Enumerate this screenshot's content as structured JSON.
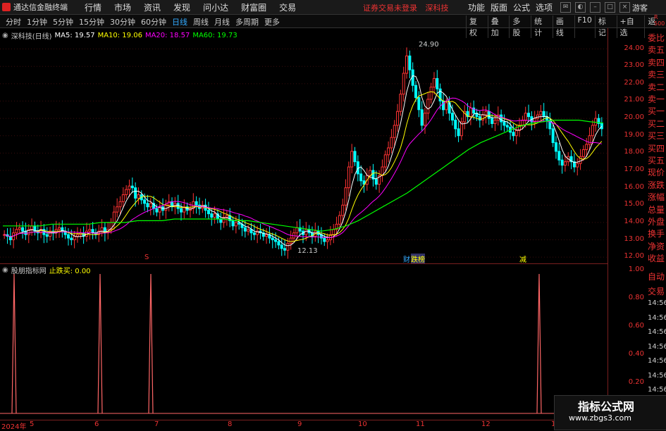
{
  "app": {
    "title": "通达信金融终端",
    "guest": "游客",
    "status_left": "证券交易未登录",
    "status_right": "深科技"
  },
  "menu": [
    "行情",
    "市场",
    "资讯",
    "发现",
    "问小达",
    "财富圈",
    "交易"
  ],
  "top_right": [
    "功能",
    "版面",
    "公式",
    "选项"
  ],
  "period_tabs": [
    "分时",
    "1分钟",
    "5分钟",
    "15分钟",
    "30分钟",
    "60分钟",
    "日线",
    "周线",
    "月线",
    "多周期",
    "更多"
  ],
  "active_tab": "日线",
  "right_tabs": [
    "复权",
    "叠加",
    "多股",
    "统计",
    "画线",
    "F10",
    "标记",
    "+自选",
    "返回"
  ],
  "legend": {
    "title": "深科技(日线)",
    "ma5": "MA5: 19.57",
    "ma10": "MA10: 19.06",
    "ma20": "MA20: 18.57",
    "ma60": "MA60: 19.73"
  },
  "colors": {
    "ma5": "#ffffff",
    "ma10": "#ffff00",
    "ma20": "#ff00ff",
    "ma60": "#00ff00",
    "up": "#ff3333",
    "down": "#00ffff",
    "indicator": "#ff6666"
  },
  "price_axis": [
    "24.00",
    "23.00",
    "22.00",
    "21.00",
    "20.00",
    "19.00",
    "18.00",
    "17.00",
    "16.00",
    "15.00",
    "14.00",
    "13.00",
    "12.00"
  ],
  "sub_axis": [
    "1.00",
    "0.80",
    "0.60",
    "0.40",
    "0.20"
  ],
  "annotations": {
    "high": "24.90",
    "low": "12.13",
    "marker_s": "S",
    "marker_c": "财",
    "marker_rank": "跌榜",
    "marker_j": "减"
  },
  "side_panel": [
    "委比",
    "卖五",
    "卖四",
    "卖三",
    "卖二",
    "卖一",
    "买一",
    "买二",
    "买三",
    "买四",
    "买五",
    "现价",
    "涨跌",
    "涨幅",
    "总量",
    "外盘",
    "换手",
    "净资",
    "收益"
  ],
  "side_sub": [
    "自动",
    "交易",
    "14:56",
    "14:56",
    "14:56",
    "14:56",
    "14:56",
    "14:56",
    "14:56",
    "14:56"
  ],
  "side_r": "R 500",
  "sub_legend": {
    "name": "股朋指标网",
    "value": "止跌买: 0.00"
  },
  "x_labels": [
    "2024年",
    "5",
    "6",
    "7",
    "8",
    "9",
    "10",
    "11",
    "12",
    "1"
  ],
  "watermark": {
    "line1": "指标公式网",
    "line2": "www.zbgs3.com"
  },
  "chart_data": {
    "type": "candlestick",
    "ylim": [
      11.6,
      25.2
    ],
    "closes": [
      13.3,
      13.2,
      13.0,
      13.4,
      13.6,
      13.7,
      13.5,
      13.3,
      13.6,
      13.8,
      13.5,
      13.4,
      13.6,
      13.3,
      13.2,
      13.5,
      13.4,
      13.6,
      13.7,
      13.5,
      13.3,
      13.1,
      13.0,
      13.2,
      13.3,
      13.4,
      13.2,
      13.5,
      13.6,
      13.4,
      13.3,
      13.5,
      13.7,
      13.4,
      13.6,
      14.0,
      14.6,
      14.9,
      15.2,
      15.6,
      15.9,
      16.1,
      16.0,
      15.4,
      15.6,
      15.3,
      15.1,
      14.9,
      15.1,
      14.8,
      14.6,
      14.9,
      14.7,
      15.0,
      15.2,
      14.9,
      15.1,
      14.8,
      14.6,
      14.9,
      14.7,
      14.8,
      15.2,
      15.0,
      14.8,
      15.0,
      14.7,
      14.5,
      14.3,
      14.5,
      14.2,
      14.0,
      14.3,
      14.4,
      14.1,
      13.8,
      14.0,
      13.9,
      13.7,
      13.5,
      13.6,
      13.4,
      13.3,
      13.5,
      13.4,
      13.2,
      13.3,
      13.1,
      13.0,
      12.9,
      12.7,
      12.5,
      12.4,
      12.8,
      13.1,
      13.4,
      13.7,
      13.5,
      13.3,
      13.6,
      13.4,
      13.2,
      13.5,
      13.3,
      13.1,
      12.9,
      13.0,
      13.3,
      13.6,
      13.9,
      14.4,
      15.0,
      16.0,
      17.2,
      18.1,
      17.5,
      16.8,
      16.4,
      16.2,
      16.7,
      17.0,
      16.5,
      16.2,
      16.7,
      17.2,
      17.9,
      18.3,
      18.9,
      19.6,
      20.4,
      21.4,
      22.6,
      23.6,
      22.8,
      21.9,
      21.2,
      20.5,
      19.6,
      20.3,
      21.1,
      21.8,
      22.3,
      21.7,
      21.0,
      20.5,
      20.9,
      20.3,
      19.9,
      19.4,
      19.0,
      19.8,
      20.4,
      20.1,
      20.6,
      20.3,
      20.1,
      19.9,
      20.2,
      20.4,
      20.0,
      19.7,
      19.9,
      20.2,
      19.8,
      19.6,
      19.5,
      19.2,
      19.0,
      19.3,
      19.6,
      19.9,
      20.3,
      20.1,
      19.8,
      20.0,
      20.2,
      20.4,
      20.1,
      19.9,
      19.4,
      18.6,
      18.1,
      17.6,
      17.3,
      17.5,
      17.8,
      17.5,
      17.2,
      17.4,
      17.8,
      18.2,
      18.5,
      19.0,
      19.6,
      20.0,
      19.7,
      19.4
    ],
    "ma60_points": [
      13.8,
      13.8,
      13.8,
      13.8,
      13.9,
      13.9,
      13.9,
      13.9,
      14.0,
      14.0,
      14.0,
      14.1,
      14.1,
      14.1,
      14.2,
      14.2,
      14.2,
      14.2,
      14.2,
      14.1,
      14.1,
      14.0,
      13.9,
      13.8,
      13.7,
      13.6,
      13.5,
      13.6,
      13.8,
      14.1,
      14.5,
      14.9,
      15.3,
      15.7,
      16.2,
      16.7,
      17.2,
      17.7,
      18.2,
      18.6,
      18.9,
      19.2,
      19.5,
      19.7,
      19.8,
      19.9,
      19.9,
      19.9,
      19.8,
      19.73
    ],
    "indicator_spikes_x": [
      20,
      142,
      214,
      765
    ]
  }
}
